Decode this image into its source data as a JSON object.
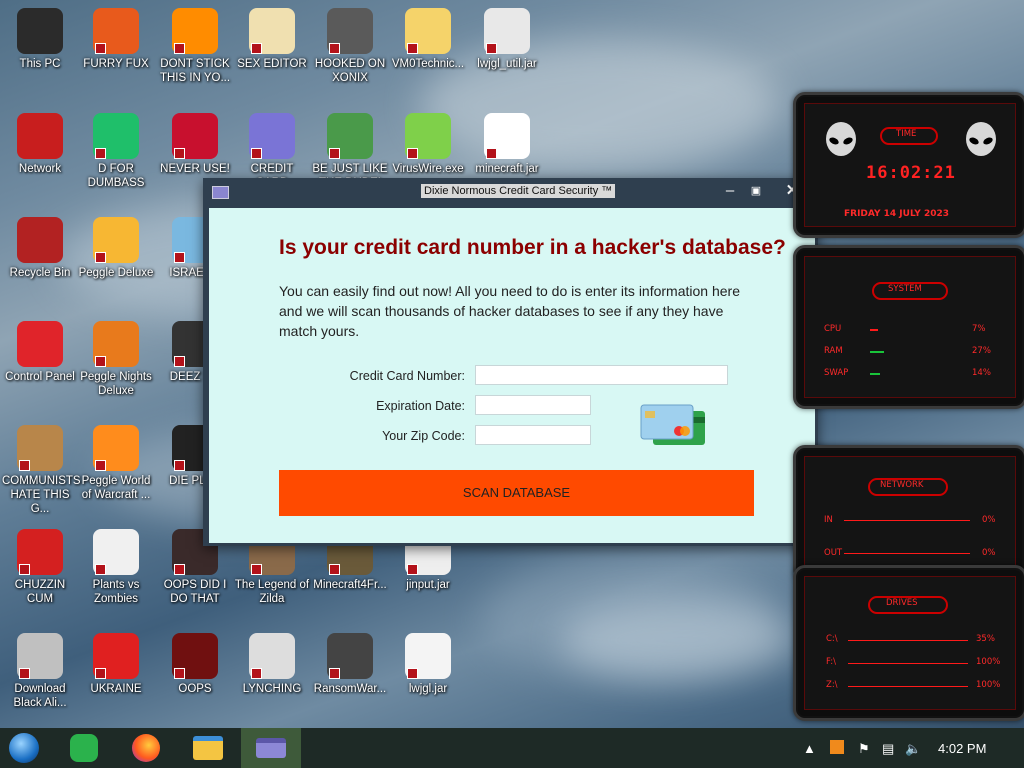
{
  "desktop_icons": [
    {
      "label": "This PC",
      "name": "this-pc"
    },
    {
      "label": "FURRY FUX",
      "name": "furry-fux"
    },
    {
      "label": "DONT STICK\nTHIS IN YO...",
      "name": "dont-stick"
    },
    {
      "label": "SEX EDITOR",
      "name": "sex-editor"
    },
    {
      "label": "HOOKED ON\nXONIX",
      "name": "hooked-on-xonix"
    },
    {
      "label": "VM0Technic...",
      "name": "vm0technic"
    },
    {
      "label": "lwjgl_util.jar",
      "name": "lwjgl-util-jar"
    },
    {
      "label": "Network",
      "name": "network"
    },
    {
      "label": "D FOR\nDUMBASS",
      "name": "d-for-dumbass"
    },
    {
      "label": "NEVER USE!",
      "name": "never-use"
    },
    {
      "label": "CREDIT CARD\nCHECKER",
      "name": "credit-card-checker"
    },
    {
      "label": "BE JUST LIKE\nTHE DUDE!",
      "name": "be-just-like-the-dude"
    },
    {
      "label": "VirusWire.exe",
      "name": "viruswire"
    },
    {
      "label": "minecraft.jar",
      "name": "minecraft-jar"
    },
    {
      "label": "Recycle Bin",
      "name": "recycle-bin"
    },
    {
      "label": "Peggle Deluxe",
      "name": "peggle-deluxe"
    },
    {
      "label": "ISRAEL S",
      "name": "israel"
    },
    {
      "label": "Control Panel",
      "name": "control-panel"
    },
    {
      "label": "Peggle Nights\nDeluxe",
      "name": "peggle-nights"
    },
    {
      "label": "DEEZ NU",
      "name": "deez-nu"
    },
    {
      "label": "COMMUNISTS\nHATE THIS G...",
      "name": "communists"
    },
    {
      "label": "Peggle World\nof Warcraft ...",
      "name": "peggle-wow"
    },
    {
      "label": "DIE PLEA",
      "name": "die-plea"
    },
    {
      "label": "CHUZZIN\nCUM",
      "name": "chuzzin"
    },
    {
      "label": "Plants vs\nZombies",
      "name": "plants-vs-zombies"
    },
    {
      "label": "OOPS DID I\nDO THAT",
      "name": "oops-did-i"
    },
    {
      "label": "The Legend of\nZilda",
      "name": "legend-of-zilda"
    },
    {
      "label": "Minecraft4Fr...",
      "name": "minecraft4fr"
    },
    {
      "label": "jinput.jar",
      "name": "jinput-jar"
    },
    {
      "label": "Download\nBlack Ali...",
      "name": "download-black-ali"
    },
    {
      "label": "UKRAINE",
      "name": "ukraine"
    },
    {
      "label": "OOPS",
      "name": "oops"
    },
    {
      "label": "LYNCHING",
      "name": "lynching"
    },
    {
      "label": "RansomWar...",
      "name": "ransomwar"
    },
    {
      "label": "lwjgl.jar",
      "name": "lwjgl-jar"
    }
  ],
  "window": {
    "title": "Dixie Normous Credit Card Security ™",
    "heading": "Is your credit card number in a hacker's database?",
    "description": "You can easily find out now! All you need to do is enter its information here and we will scan thousands of hacker databases to see if any they have match yours.",
    "fields": {
      "card_number_label": "Credit Card Number:",
      "card_number_value": "",
      "expiration_label": "Expiration Date:",
      "expiration_value": "",
      "zip_label": "Your Zip Code:",
      "zip_value": ""
    },
    "scan_button": "SCAN DATABASE"
  },
  "widgets": {
    "time": {
      "title": "TIME",
      "clock": "16:02:21",
      "date": "FRIDAY 14 JULY 2023"
    },
    "system": {
      "title": "SYSTEM",
      "rows": [
        {
          "label": "CPU",
          "value": "7%"
        },
        {
          "label": "RAM",
          "value": "27%"
        },
        {
          "label": "SWAP",
          "value": "14%"
        }
      ]
    },
    "network": {
      "title": "NETWORK",
      "rows": [
        {
          "label": "IN",
          "value": "0%"
        },
        {
          "label": "OUT",
          "value": "0%"
        }
      ]
    },
    "drives": {
      "title": "DRIVES",
      "rows": [
        {
          "label": "C:\\",
          "value": "35%"
        },
        {
          "label": "F:\\",
          "value": "100%"
        },
        {
          "label": "Z:\\",
          "value": "100%"
        }
      ]
    }
  },
  "taskbar": {
    "clock": "4:02 PM",
    "apps": [
      "start-orb",
      "feedly",
      "firefox",
      "file-explorer",
      "credit-card-checker"
    ]
  },
  "colors": {
    "window_bg": "#d8f8f4",
    "heading": "#8b0000",
    "scan_button": "#ff4a00",
    "widget_red": "#ff2222"
  }
}
